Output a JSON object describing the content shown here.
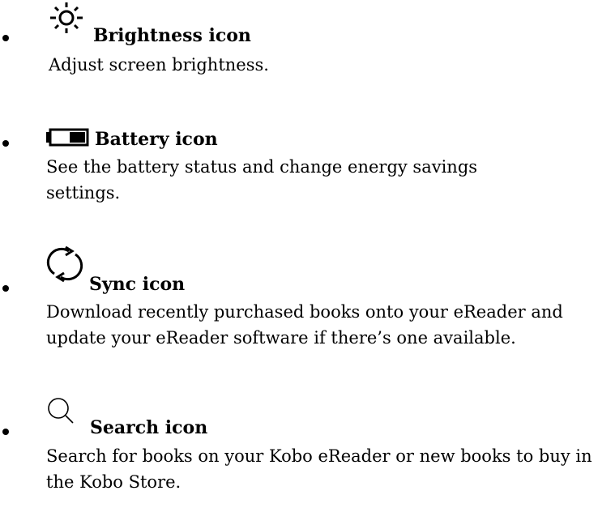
{
  "items": [
    {
      "icon": "sun-icon",
      "title": "Brightness icon",
      "description": "Adjust screen brightness."
    },
    {
      "icon": "battery-icon",
      "title": "Battery icon",
      "description": "See the battery status and change energy savings settings."
    },
    {
      "icon": "sync-icon",
      "title": "Sync icon",
      "description": "Download recently purchased books onto your eReader and update your eReader software if there’s one available."
    },
    {
      "icon": "magnifier-icon",
      "title": "Search icon",
      "description": "Search for books on your Kobo eReader or new books to buy in the Kobo Store."
    }
  ]
}
